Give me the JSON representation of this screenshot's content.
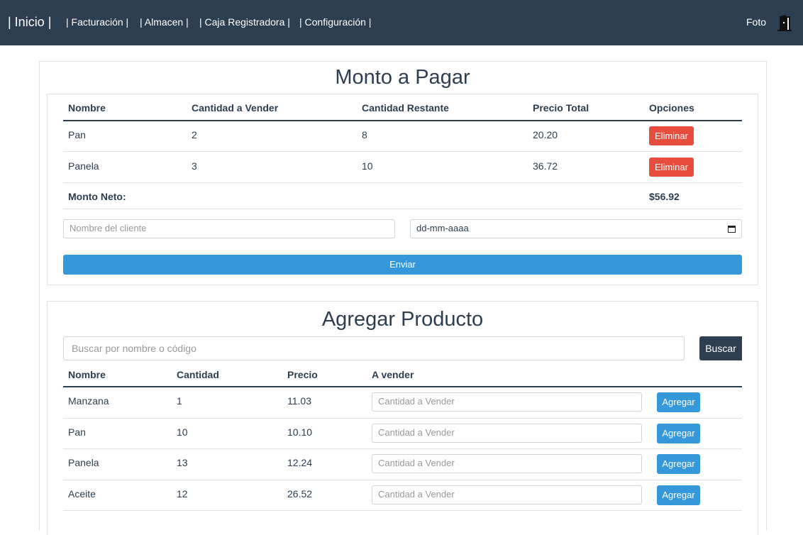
{
  "navbar": {
    "brand": "| Inicio |",
    "links": [
      "| Facturación |",
      "| Almacen |",
      "| Caja Registradora |",
      "| Configuración |"
    ],
    "user_label": "Foto",
    "exit_icon": "door-exit-icon"
  },
  "pay_section": {
    "title": "Monto a Pagar",
    "columns": [
      "Nombre",
      "Cantidad a Vender",
      "Cantidad Restante",
      "Precio Total",
      "Opciones"
    ],
    "rows": [
      {
        "nombre": "Pan",
        "cantidad_vender": "2",
        "cantidad_restante": "8",
        "precio_total": "20.20",
        "action": "Eliminar"
      },
      {
        "nombre": "Panela",
        "cantidad_vender": "3",
        "cantidad_restante": "10",
        "precio_total": "36.72",
        "action": "Eliminar"
      }
    ],
    "net_label": "Monto Neto:",
    "net_value": "$56.92",
    "client_placeholder": "Nombre del cliente",
    "date_value": "dd-mm-aaaa",
    "submit_label": "Enviar"
  },
  "add_section": {
    "title": "Agregar Producto",
    "search_placeholder": "Buscar por nombre o código",
    "search_button": "Buscar",
    "columns": [
      "Nombre",
      "Cantidad",
      "Precio",
      "A vender"
    ],
    "qty_placeholder": "Cantidad a Vender",
    "add_label": "Agregar",
    "rows": [
      {
        "nombre": "Manzana",
        "cantidad": "1",
        "precio": "11.03"
      },
      {
        "nombre": "Pan",
        "cantidad": "10",
        "precio": "10.10"
      },
      {
        "nombre": "Panela",
        "cantidad": "13",
        "precio": "12.24"
      },
      {
        "nombre": "Aceite",
        "cantidad": "12",
        "precio": "26.52"
      }
    ]
  },
  "colors": {
    "navbar": "#2c3e50",
    "primary": "#3498db",
    "danger": "#e74c3c"
  }
}
